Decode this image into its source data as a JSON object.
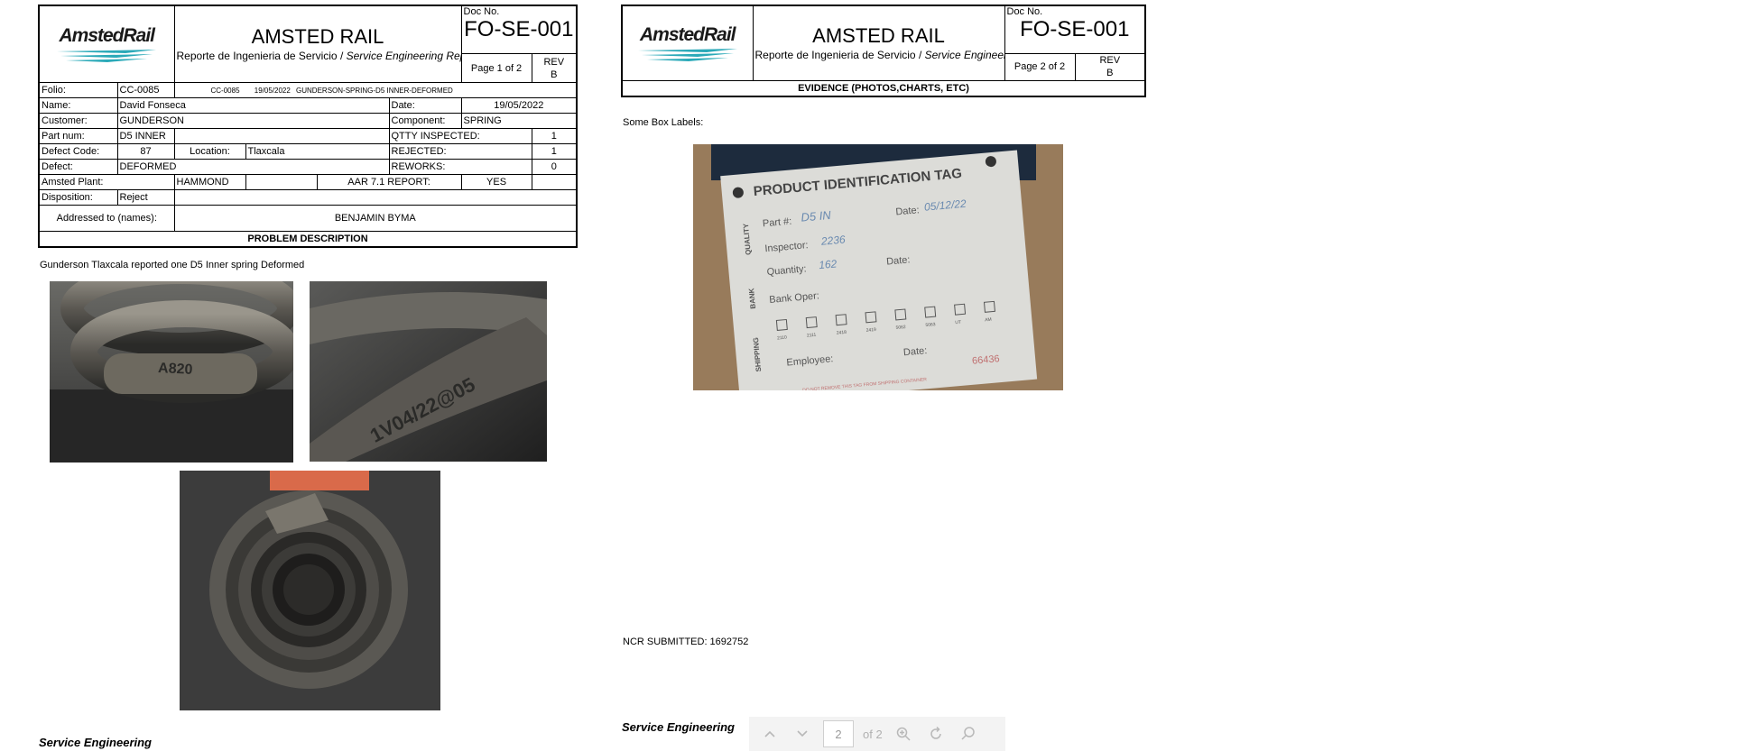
{
  "header": {
    "logo": "AmstedRail",
    "company": "AMSTED RAIL",
    "subtitle_es": "Reporte de Ingenieria de Servicio / ",
    "subtitle_en": "Service Engineering Report",
    "doc_no_label": "Doc No.",
    "doc_no": "FO-SE-001",
    "rev_label": "REV",
    "rev": "B"
  },
  "page1": {
    "page_label": "Page  1  of  2",
    "fields": {
      "folio_label": "Folio:",
      "folio": "CC-0085",
      "folio_ref": "CC-0085",
      "folio_date": "19/05/2022",
      "folio_desc": "GUNDERSON-SPRING-D5 INNER-DEFORMED",
      "name_label": "Name:",
      "name": "David Fonseca",
      "date_label": "Date:",
      "date": "19/05/2022",
      "customer_label": "Customer:",
      "customer": "GUNDERSON",
      "component_label": "Component:",
      "component": "SPRING",
      "part_label": "Part num:",
      "part": "D5 INNER",
      "qtty_label": "QTTY INSPECTED:",
      "qtty": "1",
      "defect_code_label": "Defect Code:",
      "defect_code": "87",
      "location_label": "Location:",
      "location": "Tlaxcala",
      "rejected_label": "REJECTED:",
      "rejected": "1",
      "defect_label": "Defect:",
      "defect": "DEFORMED",
      "reworks_label": "REWORKS:",
      "reworks": "0",
      "plant_label": "Amsted Plant:",
      "plant": "HAMMOND",
      "aar_label": "AAR 7.1 REPORT:",
      "aar": "YES",
      "disposition_label": "Disposition:",
      "disposition": "Reject",
      "addressed_label": "Addressed to (names):",
      "addressed": "BENJAMIN BYMA"
    },
    "problem_head": "PROBLEM DESCRIPTION",
    "problem_text": "Gunderson Tlaxcala reported one D5 Inner spring Deformed",
    "footer": "Service Engineering"
  },
  "page2": {
    "page_label": "Page  2  of  2",
    "evidence_head": "EVIDENCE (PHOTOS,CHARTS, ETC)",
    "box_labels": "Some Box Labels:",
    "tag": {
      "title": "PRODUCT IDENTIFICATION TAG",
      "quality": "QUALITY",
      "bank": "BANK",
      "shipping": "SHIPPING",
      "part": "Part #:",
      "part_val": "D5 IN",
      "date": "Date:",
      "date_val": "05/12/22",
      "inspector": "Inspector:",
      "inspector_val": "2236",
      "quantity": "Quantity:",
      "quantity_val": "162",
      "date2": "Date:",
      "bank_oper": "Bank Oper:",
      "employee": "Employee:",
      "date3": "Date:",
      "box_codes": [
        "2110",
        "2111",
        "2418",
        "2419",
        "5062",
        "5063",
        "UT",
        "AM"
      ],
      "serial": "66436",
      "warning": "DO NOT REMOVE THIS TAG FROM SHIPPING CONTAINER"
    },
    "photo_stamp_1": "A820",
    "photo_stamp_2": "1V04/22@05",
    "ncr": "NCR SUBMITTED: 1692752",
    "footer": "Service Engineering"
  },
  "toolbar": {
    "page_value": "2",
    "of_label": "of 2"
  }
}
